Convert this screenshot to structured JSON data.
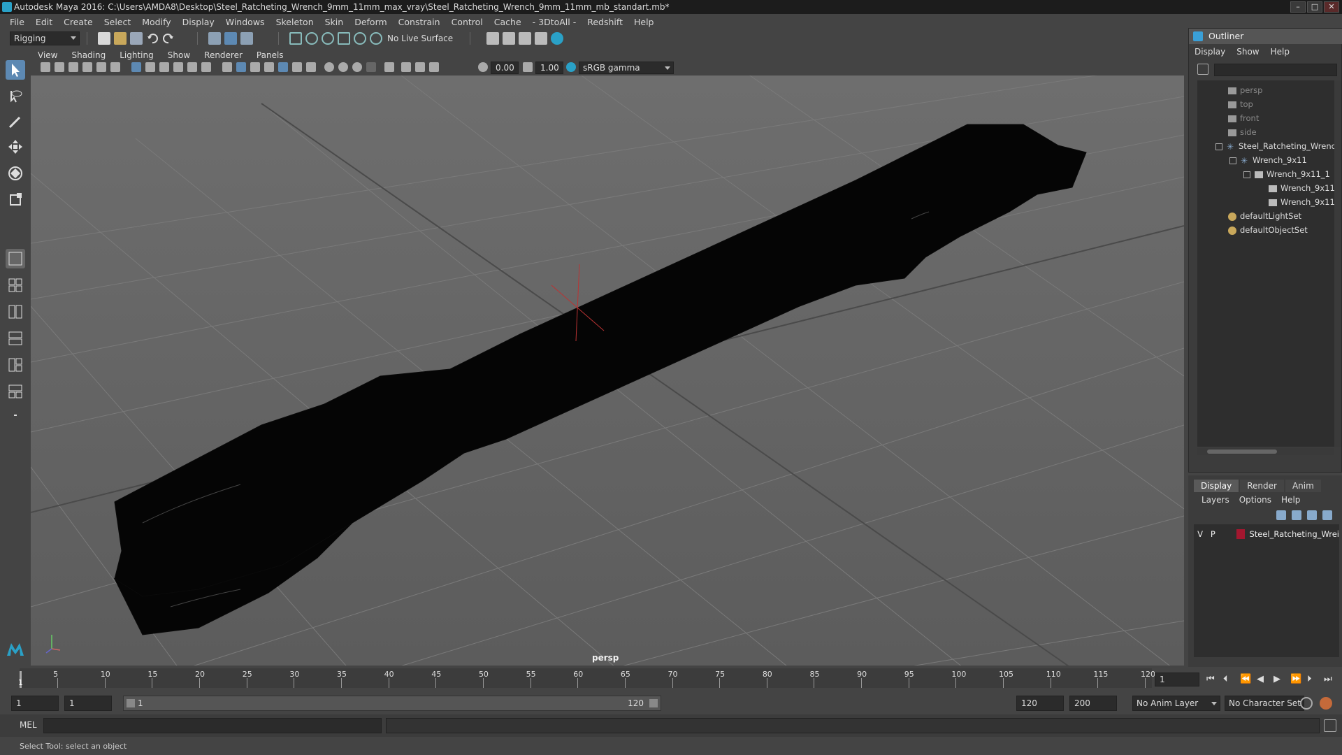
{
  "window": {
    "title": "Autodesk Maya 2016: C:\\Users\\AMDA8\\Desktop\\Steel_Ratcheting_Wrench_9mm_11mm_max_vray\\Steel_Ratcheting_Wrench_9mm_11mm_mb_standart.mb*",
    "buttons": [
      "–",
      "□",
      "✕"
    ]
  },
  "menubar": [
    "File",
    "Edit",
    "Create",
    "Select",
    "Modify",
    "Display",
    "Windows",
    "Skeleton",
    "Skin",
    "Deform",
    "Constrain",
    "Control",
    "Cache",
    "- 3DtoAll -",
    "Redshift",
    "Help"
  ],
  "shelf": {
    "mode": "Rigging",
    "live_surface": "No Live Surface"
  },
  "viewport": {
    "menu": [
      "View",
      "Shading",
      "Lighting",
      "Show",
      "Renderer",
      "Panels"
    ],
    "exposure": "0.00",
    "gamma": "1.00",
    "color_space": "sRGB gamma",
    "camera_label": "persp"
  },
  "outliner": {
    "title": "Outliner",
    "menu": [
      "Display",
      "Show",
      "Help"
    ],
    "items": [
      {
        "label": "persp",
        "dim": true,
        "icon": "camera-icon"
      },
      {
        "label": "top",
        "dim": true,
        "icon": "camera-icon"
      },
      {
        "label": "front",
        "dim": true,
        "icon": "camera-icon"
      },
      {
        "label": "side",
        "dim": true,
        "icon": "camera-icon"
      },
      {
        "label": "Steel_Ratcheting_Wrenc",
        "dim": false,
        "icon": "group-icon"
      },
      {
        "label": "Wrench_9x11",
        "dim": false,
        "icon": "group-icon"
      },
      {
        "label": "Wrench_9x11_1",
        "dim": false,
        "icon": "mesh-icon"
      },
      {
        "label": "Wrench_9x11",
        "dim": false,
        "icon": "mesh-icon"
      },
      {
        "label": "Wrench_9x11",
        "dim": false,
        "icon": "mesh-icon"
      },
      {
        "label": "defaultLightSet",
        "dim": false,
        "icon": "set-icon"
      },
      {
        "label": "defaultObjectSet",
        "dim": false,
        "icon": "set-icon"
      }
    ]
  },
  "layers": {
    "tabs": [
      "Display",
      "Render",
      "Anim"
    ],
    "menu": [
      "Layers",
      "Options",
      "Help"
    ],
    "row": {
      "v": "V",
      "p": "P",
      "name": "Steel_Ratcheting_Wrei",
      "color": "#a3172f"
    }
  },
  "timeline": {
    "ticks": [
      "5",
      "10",
      "15",
      "20",
      "25",
      "30",
      "35",
      "40",
      "45",
      "50",
      "55",
      "60",
      "65",
      "70",
      "75",
      "80",
      "85",
      "90",
      "95",
      "100",
      "105",
      "110",
      "115",
      "120"
    ],
    "current_frame_marker": "1",
    "current_frame_field": "1"
  },
  "range": {
    "start": "1",
    "start2": "1",
    "slider_start": "1",
    "slider_end": "120",
    "end": "120",
    "max": "200",
    "anim_layer": "No Anim Layer",
    "character_set": "No Character Set"
  },
  "command": {
    "label": "MEL"
  },
  "help_line": "Select Tool: select an object"
}
